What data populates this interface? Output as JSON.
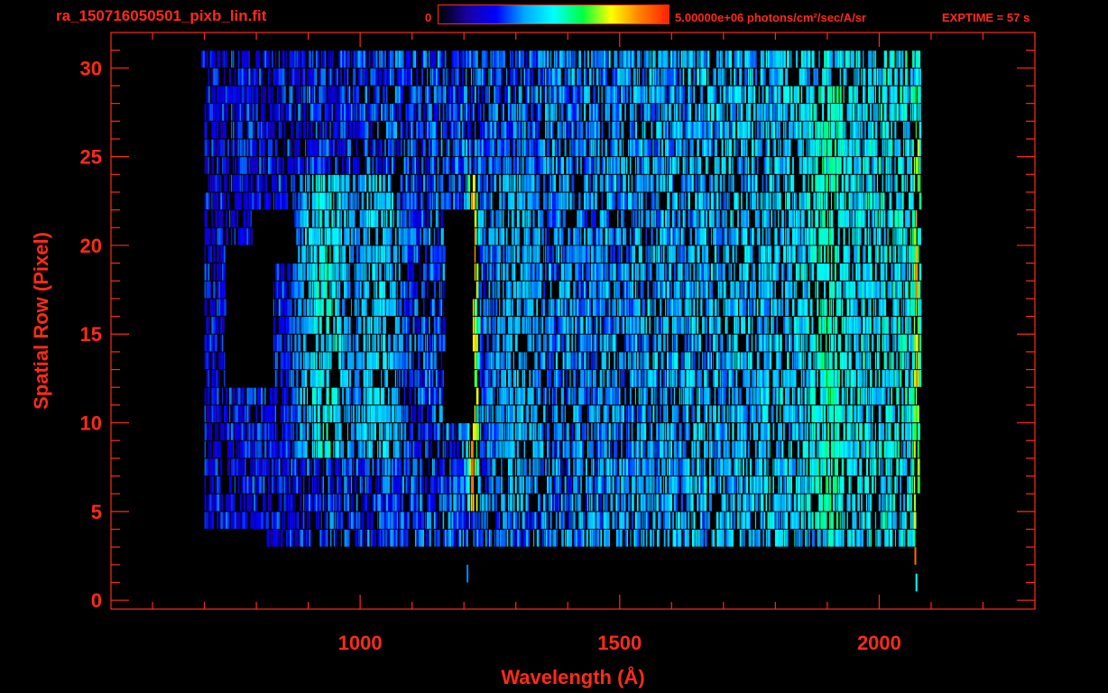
{
  "header": {
    "file_name": "ra_150716050501_pixb_lin.fit",
    "colorbar_min": "0",
    "colorbar_max": "5.00000e+06 photons/cm²/sec/A/sr",
    "exptime": "EXPTIME = 57 s"
  },
  "colors": {
    "axis": "#ff2a1a",
    "colormap": [
      "#000000",
      "#1a00a0",
      "#0000ff",
      "#00aaff",
      "#00ffff",
      "#00ff40",
      "#ffff00",
      "#ff8000",
      "#ff2000"
    ]
  },
  "chart_data": {
    "type": "heatmap",
    "title": "ra_150716050501_pixb_lin.fit",
    "xlabel": "Wavelength (Å)",
    "ylabel": "Spatial Row (Pixel)",
    "xlim": [
      520,
      2300
    ],
    "ylim": [
      -0.5,
      32
    ],
    "x_ticks": [
      1000,
      1500,
      2000
    ],
    "y_ticks": [
      0,
      5,
      10,
      15,
      20,
      25,
      30
    ],
    "colorbar": {
      "min": 0,
      "max": 5000000,
      "unit": "photons/cm²/sec/A/sr"
    },
    "row_extent": [
      [
        3,
        820,
        2070
      ],
      [
        4,
        700,
        2070
      ],
      [
        5,
        700,
        2070
      ],
      [
        6,
        700,
        2075
      ],
      [
        7,
        700,
        2075
      ],
      [
        8,
        700,
        2075
      ],
      [
        9,
        700,
        2075
      ],
      [
        10,
        700,
        2075
      ],
      [
        11,
        700,
        2075
      ],
      [
        12,
        700,
        2080
      ],
      [
        13,
        700,
        2080
      ],
      [
        14,
        700,
        2080
      ],
      [
        15,
        700,
        2080
      ],
      [
        16,
        700,
        2080
      ],
      [
        17,
        700,
        2080
      ],
      [
        18,
        700,
        2080
      ],
      [
        19,
        700,
        2080
      ],
      [
        20,
        700,
        2080
      ],
      [
        21,
        700,
        2080
      ],
      [
        22,
        700,
        2080
      ],
      [
        23,
        700,
        2080
      ],
      [
        24,
        700,
        2080
      ],
      [
        25,
        700,
        2080
      ],
      [
        26,
        700,
        2080
      ],
      [
        27,
        700,
        2080
      ],
      [
        28,
        700,
        2080
      ],
      [
        29,
        700,
        2080
      ],
      [
        30,
        690,
        2075
      ]
    ],
    "gaps": [
      [
        17,
        21,
        1160,
        1220
      ],
      [
        10,
        16,
        1160,
        1215
      ],
      [
        19,
        21,
        790,
        870
      ],
      [
        12,
        19,
        740,
        830
      ]
    ],
    "bright_features": [
      {
        "name": "line-1216",
        "x": 1216,
        "rows": [
          4.5,
          23
        ],
        "level": 0.95
      },
      {
        "name": "band-930",
        "x": 930,
        "rows": [
          8,
          23
        ],
        "level": 0.55
      },
      {
        "name": "band-1030",
        "x": 1030,
        "rows": [
          8,
          23
        ],
        "level": 0.5
      },
      {
        "name": "band-1300",
        "x": 1300,
        "rows": [
          5,
          23
        ],
        "level": 0.45
      },
      {
        "name": "band-1900",
        "x": 1900,
        "rows": [
          4,
          28
        ],
        "level": 0.6
      },
      {
        "name": "edge-2070",
        "x": 2070,
        "rows": [
          3,
          28
        ],
        "level": 0.85
      }
    ],
    "isolated_pixels": [
      [
        1205,
        1,
        0.35
      ],
      [
        2068,
        2,
        0.9
      ],
      [
        2070,
        0.5,
        0.5
      ]
    ]
  }
}
